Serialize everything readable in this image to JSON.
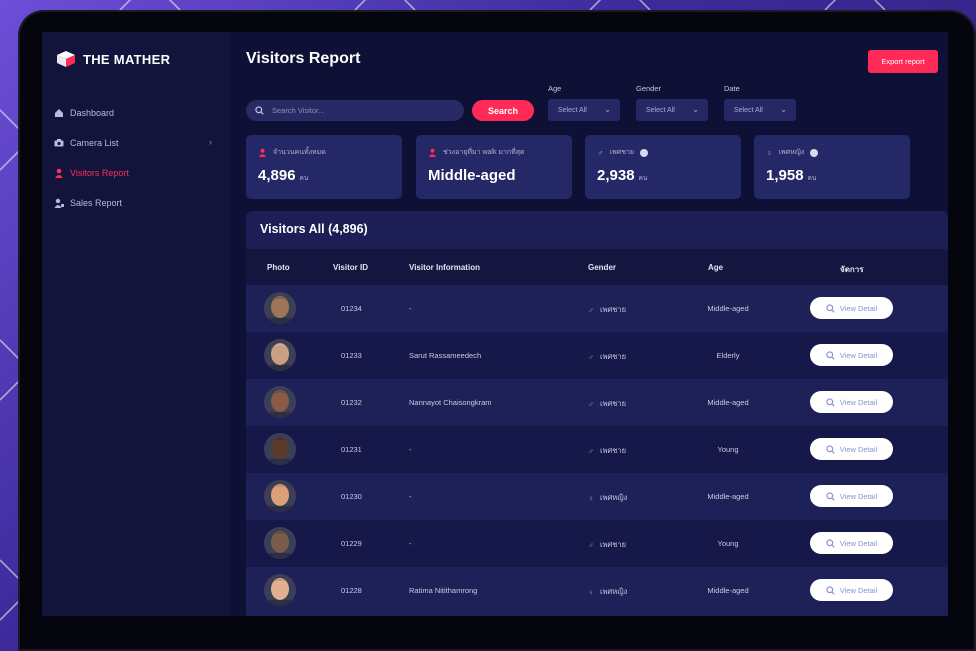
{
  "brand": {
    "name": "THE MATHER",
    "accent": "#ff2a55"
  },
  "sidebar": {
    "items": [
      {
        "label": "Dashboard",
        "icon": "home-icon",
        "active": false
      },
      {
        "label": "Camera List",
        "icon": "camera-icon",
        "active": false,
        "has_submenu": true
      },
      {
        "label": "Visitors Report",
        "icon": "user-icon",
        "active": true
      },
      {
        "label": "Sales Report",
        "icon": "sales-user-icon",
        "active": false
      }
    ]
  },
  "header": {
    "title": "Visitors Report",
    "export_label": "Export report"
  },
  "search": {
    "placeholder": "Search Visitor...",
    "button_label": "Search"
  },
  "filters": [
    {
      "label": "Age",
      "value": "Select All"
    },
    {
      "label": "Gender",
      "value": "Select All"
    },
    {
      "label": "Date",
      "value": "Select All"
    }
  ],
  "stats": [
    {
      "label": "จำนวนคนทั้งหมด",
      "value": "4,896",
      "unit": "คน",
      "icon": "people-icon",
      "icon_color": "#ff2a55",
      "info": false
    },
    {
      "label": "ช่วงอายุที่มา walk มากที่สุด",
      "value": "Middle-aged",
      "unit": "",
      "icon": "people-icon",
      "icon_color": "#ff2a55",
      "info": false
    },
    {
      "label": "เพศชาย",
      "value": "2,938",
      "unit": "คน",
      "icon": "male-icon",
      "icon_color": "#2fd3b4",
      "info": true
    },
    {
      "label": "เพศหญิง",
      "value": "1,958",
      "unit": "คน",
      "icon": "female-icon",
      "icon_color": "#c46cff",
      "info": true
    }
  ],
  "table": {
    "title": "Visitors All (4,896)",
    "headers": {
      "photo": "Photo",
      "visitor_id": "Visitor ID",
      "info": "Visitor Information",
      "gender": "Gender",
      "age": "Age",
      "action": "จัดการ"
    },
    "view_label": "View Detail",
    "rows": [
      {
        "id": "01234",
        "info": "-",
        "gender": "เพศชาย",
        "gender_icon": "male-icon",
        "age": "Middle-aged"
      },
      {
        "id": "01233",
        "info": "Sarut Rassameedech",
        "gender": "เพศชาย",
        "gender_icon": "male-icon",
        "age": "Elderly"
      },
      {
        "id": "01232",
        "info": "Nannayot Chaisongkram",
        "gender": "เพศชาย",
        "gender_icon": "male-icon",
        "age": "Middle-aged"
      },
      {
        "id": "01231",
        "info": "-",
        "gender": "เพศชาย",
        "gender_icon": "male-icon",
        "age": "Young"
      },
      {
        "id": "01230",
        "info": "-",
        "gender": "เพศหญิง",
        "gender_icon": "female-icon",
        "age": "Middle-aged"
      },
      {
        "id": "01229",
        "info": "-",
        "gender": "เพศชาย",
        "gender_icon": "male-icon",
        "age": "Young"
      },
      {
        "id": "01228",
        "info": "Ratima Nitithamrong",
        "gender": "เพศหญิง",
        "gender_icon": "female-icon",
        "age": "Middle-aged"
      }
    ]
  }
}
